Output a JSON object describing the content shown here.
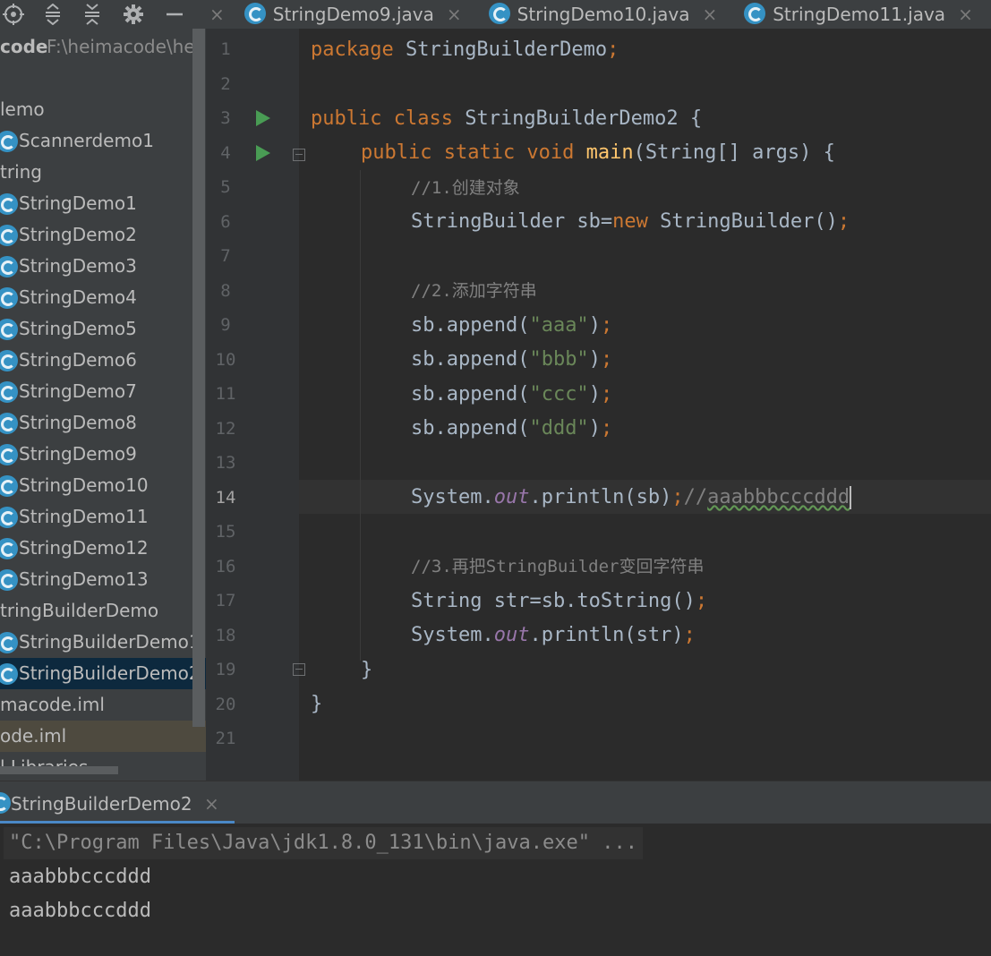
{
  "tabs": [
    {
      "label": "StringDemo9.java",
      "close": "×"
    },
    {
      "label": "StringDemo10.java",
      "close": "×"
    },
    {
      "label": "StringDemo11.java",
      "close": "×"
    }
  ],
  "project_root": {
    "name": "code",
    "path": "F:\\heimacode\\hei"
  },
  "tree": [
    "lemo",
    "Scannerdemo1",
    "tring",
    "StringDemo1",
    "StringDemo2",
    "StringDemo3",
    "StringDemo4",
    "StringDemo5",
    "StringDemo6",
    "StringDemo7",
    "StringDemo8",
    "StringDemo9",
    "StringDemo10",
    "StringDemo11",
    "StringDemo12",
    "StringDemo13",
    "tringBuilderDemo",
    "StringBuilderDemo1",
    "StringBuilderDemo2",
    "macode.iml",
    "ode.iml",
    "l Libraries"
  ],
  "line_numbers": [
    "1",
    "2",
    "3",
    "4",
    "5",
    "6",
    "7",
    "8",
    "9",
    "10",
    "11",
    "12",
    "13",
    "14",
    "15",
    "16",
    "17",
    "18",
    "19",
    "20",
    "21"
  ],
  "code": {
    "l1": {
      "kw": "package",
      "rest": " StringBuilderDemo",
      "semi": ";"
    },
    "l3": {
      "kw": "public class",
      "rest": " StringBuilderDemo2 {"
    },
    "l4": {
      "kw": "public static void",
      "fn": "main",
      "rest": "(String[] args) {"
    },
    "l5": "//1.创建对象",
    "l6": {
      "a": "StringBuilder sb=",
      "kw": "new",
      "b": " StringBuilder()",
      "semi": ";"
    },
    "l8": "//2.添加字符串",
    "l9": {
      "a": "sb.append(",
      "s": "\"aaa\"",
      "b": ")",
      "semi": ";"
    },
    "l10": {
      "a": "sb.append(",
      "s": "\"bbb\"",
      "b": ")",
      "semi": ";"
    },
    "l11": {
      "a": "sb.append(",
      "s": "\"ccc\"",
      "b": ")",
      "semi": ";"
    },
    "l12": {
      "a": "sb.append(",
      "s": "\"ddd\"",
      "b": ")",
      "semi": ";"
    },
    "l14": {
      "a": "System.",
      "fld": "out",
      "b": ".println(sb)",
      "semi": ";",
      "cmt_prefix": "//",
      "cmt": "aaabbbcccddd"
    },
    "l16": "//3.再把StringBuilder变回字符串",
    "l17": {
      "a": "String str=sb.toString()",
      "semi": ";"
    },
    "l18": {
      "a": "System.",
      "fld": "out",
      "b": ".println(str)",
      "semi": ";"
    },
    "l19": "}",
    "l20": "}"
  },
  "run": {
    "tab_label": "StringBuilderDemo2",
    "close": "×",
    "command": "\"C:\\Program Files\\Java\\jdk1.8.0_131\\bin\\java.exe\" ...",
    "output": [
      "aaabbbcccddd",
      "aaabbbcccddd"
    ]
  },
  "icons": {
    "tabs": "java-class-icon",
    "toolbar": [
      "target-icon",
      "expand-all-icon",
      "collapse-all-icon",
      "gear-icon",
      "minimize-icon"
    ]
  }
}
